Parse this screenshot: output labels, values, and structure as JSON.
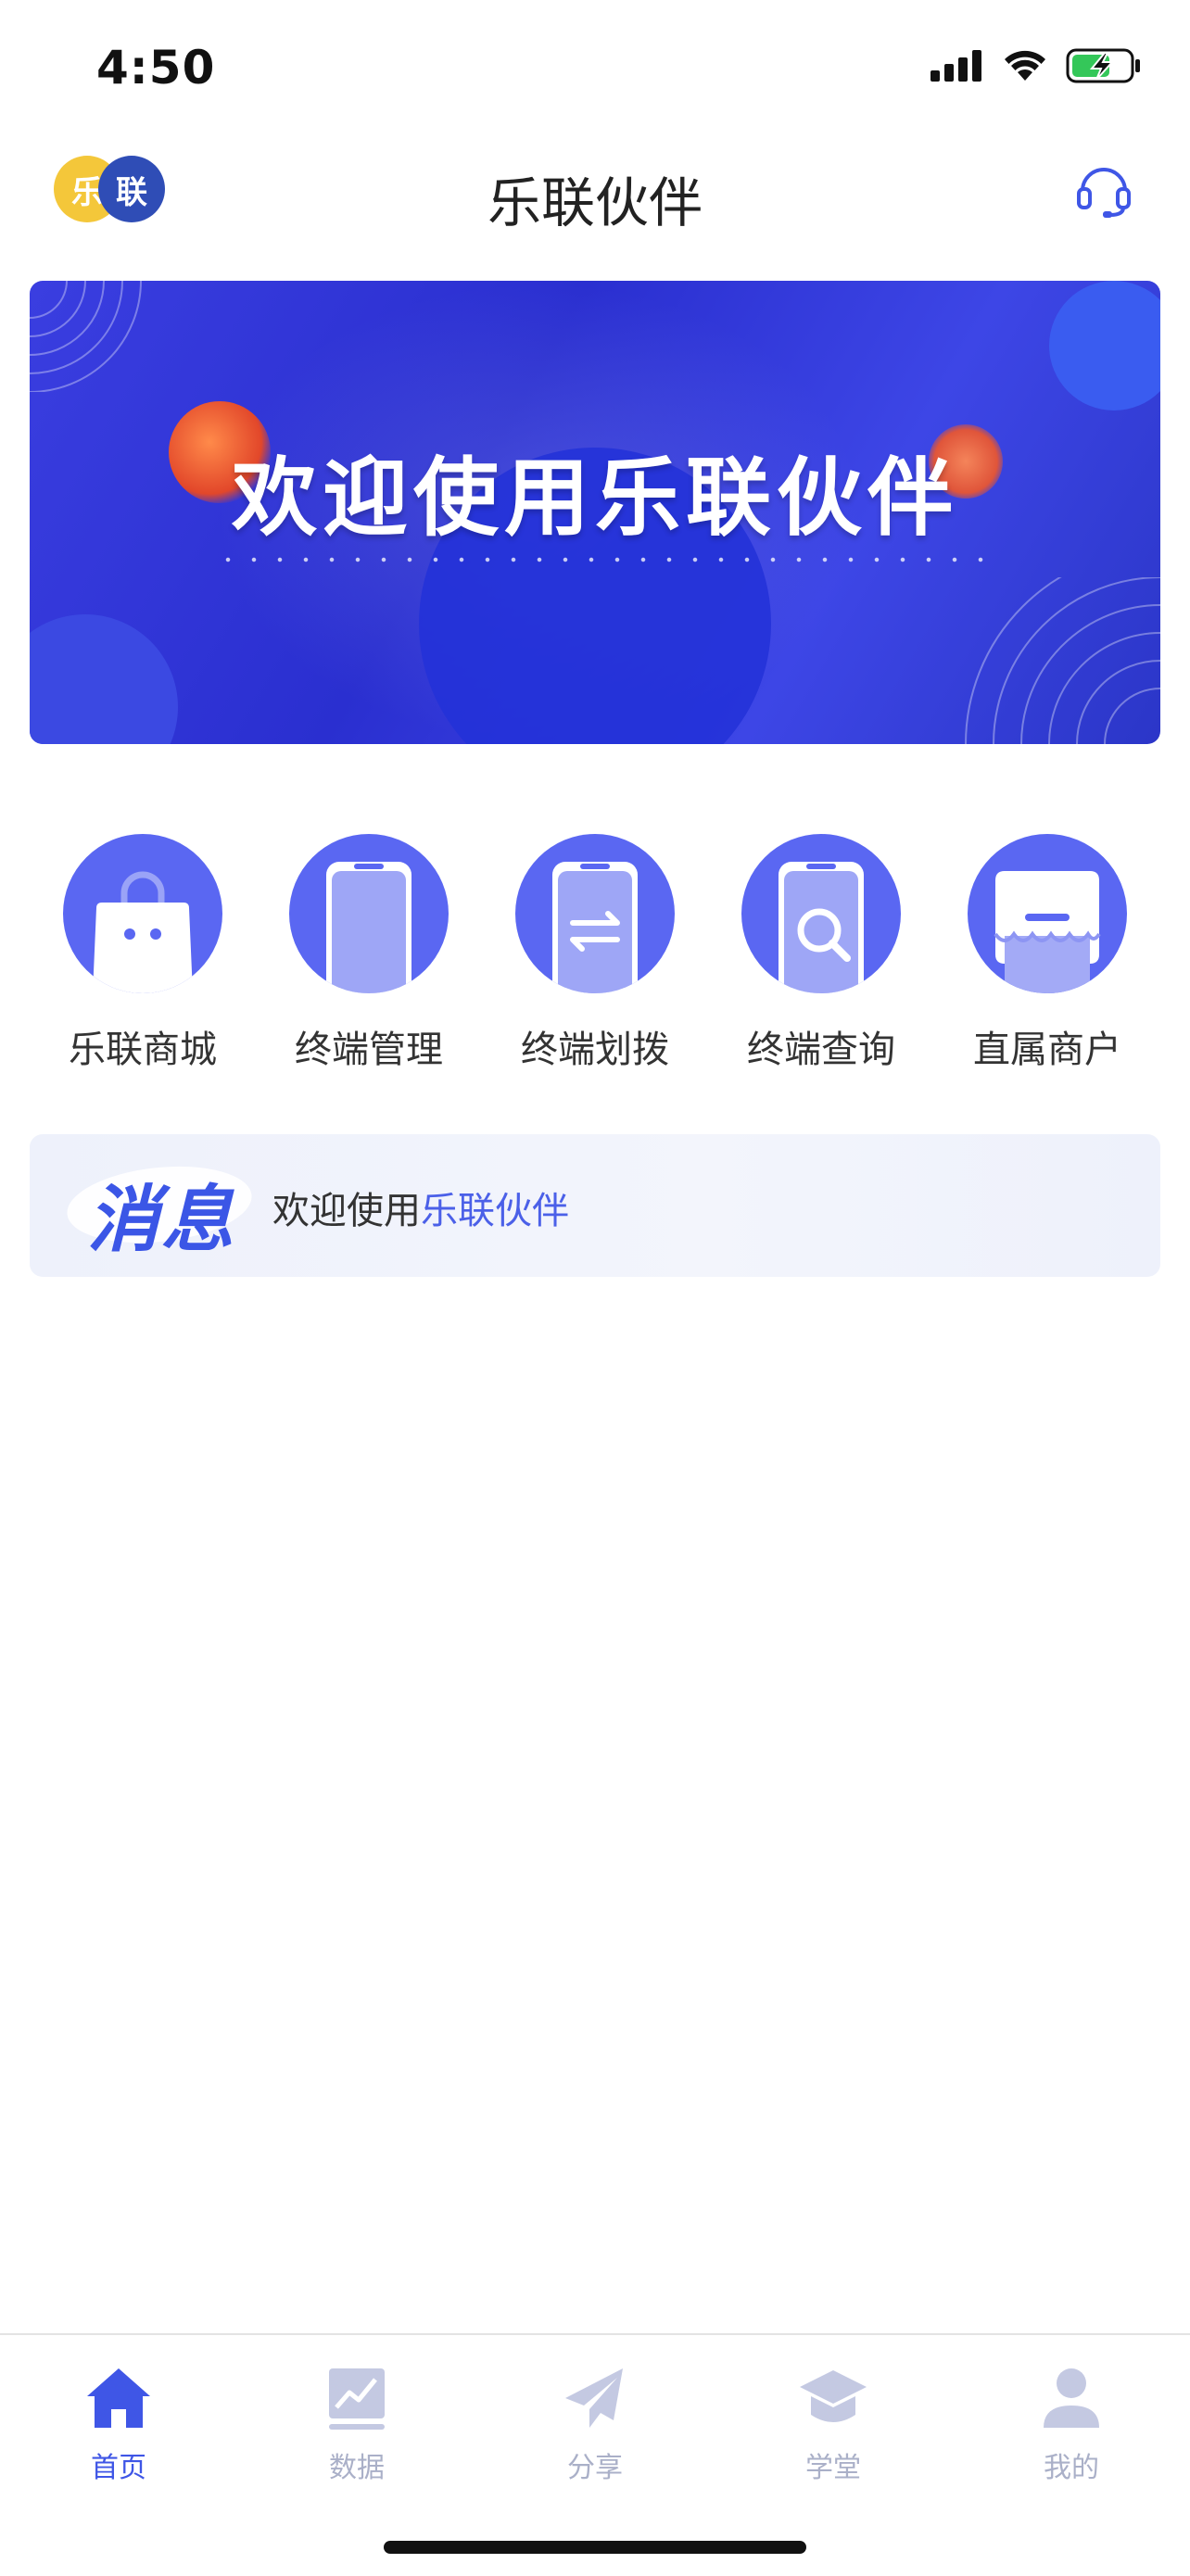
{
  "status_bar": {
    "time": "4:50"
  },
  "header": {
    "logo": {
      "left_char": "乐",
      "right_char": "联"
    },
    "title": "乐联伙伴",
    "support_icon": "headset-icon"
  },
  "banner": {
    "title": "欢迎使用乐联伙伴"
  },
  "features": [
    {
      "label": "乐联商城",
      "icon": "shopping-bag-icon"
    },
    {
      "label": "终端管理",
      "icon": "device-icon"
    },
    {
      "label": "终端划拨",
      "icon": "transfer-icon"
    },
    {
      "label": "终端查询",
      "icon": "search-device-icon"
    },
    {
      "label": "直属商户",
      "icon": "store-icon"
    }
  ],
  "message": {
    "title": "消息",
    "text_prefix": "欢迎使用",
    "text_highlight": "乐联伙伴"
  },
  "tabbar": {
    "tabs": [
      {
        "label": "首页",
        "icon": "home-icon",
        "active": true
      },
      {
        "label": "数据",
        "icon": "chart-icon",
        "active": false
      },
      {
        "label": "分享",
        "icon": "paper-plane-icon",
        "active": false
      },
      {
        "label": "学堂",
        "icon": "graduation-cap-icon",
        "active": false
      },
      {
        "label": "我的",
        "icon": "user-icon",
        "active": false
      }
    ]
  },
  "colors": {
    "accent": "#3f56e6",
    "icon_circle": "#5a67f2",
    "tab_inactive": "#aab0c8"
  }
}
